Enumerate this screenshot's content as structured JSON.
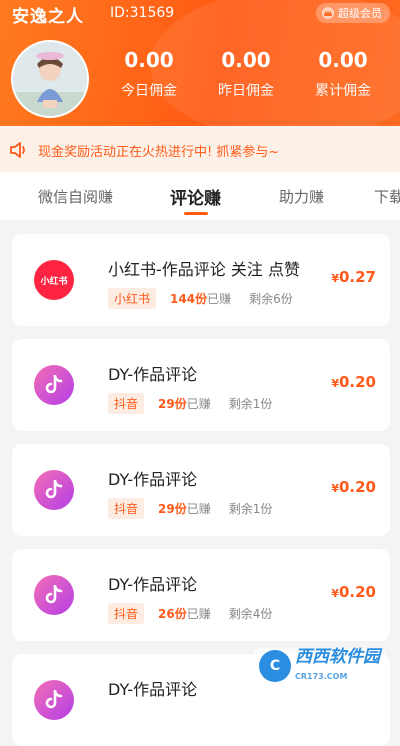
{
  "header": {
    "username": "安逸之人",
    "user_id": "ID:31569",
    "vip_label": "超级会员",
    "stats": [
      {
        "value": "0.00",
        "label": "今日佣金"
      },
      {
        "value": "0.00",
        "label": "昨日佣金"
      },
      {
        "value": "0.00",
        "label": "累计佣金"
      }
    ]
  },
  "notice": {
    "text": "现金奖励活动正在火热进行中! 抓紧参与~"
  },
  "tabs": [
    {
      "label": "微信自阅赚"
    },
    {
      "label": "评论赚",
      "active": true
    },
    {
      "label": "助力赚"
    },
    {
      "label": "下载"
    }
  ],
  "tasks": [
    {
      "icon": "xiaohongshu",
      "icon_text": "小红书",
      "title": "小红书-作品评论 关注 点赞",
      "platform": "小红书",
      "done_count": "144份",
      "done_suffix": "已赚",
      "remaining": "剩余6份",
      "currency": "¥",
      "price": "0.27"
    },
    {
      "icon": "douyin",
      "title": "DY-作品评论",
      "platform": "抖音",
      "done_count": "29份",
      "done_suffix": "已赚",
      "remaining": "剩余1份",
      "currency": "¥",
      "price": "0.20"
    },
    {
      "icon": "douyin",
      "title": "DY-作品评论",
      "platform": "抖音",
      "done_count": "29份",
      "done_suffix": "已赚",
      "remaining": "剩余1份",
      "currency": "¥",
      "price": "0.20"
    },
    {
      "icon": "douyin",
      "title": "DY-作品评论",
      "platform": "抖音",
      "done_count": "26份",
      "done_suffix": "已赚",
      "remaining": "剩余4份",
      "currency": "¥",
      "price": "0.20"
    },
    {
      "icon": "douyin",
      "title": "DY-作品评论"
    }
  ],
  "watermark": {
    "text": "西西软件园",
    "sub": "CR173.COM"
  },
  "colors": {
    "accent": "#ff5a14",
    "price": "#ff5a1a",
    "chip_bg": "#fdece2",
    "notice_bg": "#fdf1e7"
  }
}
